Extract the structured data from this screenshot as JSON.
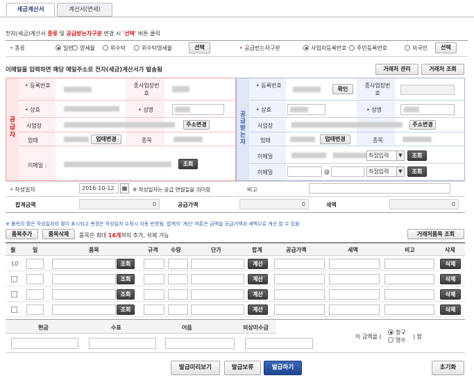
{
  "tabs": [
    "세금계산서",
    "계산서(면세)"
  ],
  "notice": {
    "p1": "전자(세금)계산서 ",
    "k1": "종류",
    "p2": " 및 ",
    "k2": "공급받는자구분",
    "p3": " 변경 시 ",
    "k3": "'선택'",
    "p4": " 버튼 클릭"
  },
  "kind": {
    "label": "종류",
    "options": [
      "일반",
      "영세율",
      "위수탁",
      "위수탁영세율"
    ],
    "selected": "일반",
    "button": "선택"
  },
  "recipient_type": {
    "label": "공급받는자구분",
    "options": [
      "사업자등록번호",
      "주민등록번호",
      "외국인"
    ],
    "selected": "사업자등록번호",
    "button": "선택"
  },
  "email_notice": "이메일을 입력하면 해당 메일주소로 전자(세금)계산서가 발송됨",
  "top_buttons": {
    "manage": "거래처 관리",
    "search": "거래처 조회"
  },
  "supplier": {
    "side_label": "공급자",
    "reg_no": "등록번호",
    "sub_no": "종사업장번호",
    "name": "상호",
    "ceo": "성명",
    "address": "사업장",
    "address_btn": "주소변경",
    "type": "업태",
    "type_btn": "업태변경",
    "item": "종목",
    "email": "이메일",
    "email_btn": "조회"
  },
  "buyer": {
    "side_label": "공급받는자",
    "reg_no": "등록번호",
    "confirm": "확인",
    "sub_no": "종사업장번호",
    "name": "상호",
    "ceo": "성명",
    "address": "사업장",
    "address_btn": "주소변경",
    "type": "업태",
    "type_btn": "업태변경",
    "item": "종목",
    "email": "이메일",
    "email2": "이메일",
    "at": "@",
    "direct": "직접입력",
    "email_btn": "조회"
  },
  "date": {
    "label": "작성일자",
    "value": "2016-10-12",
    "note": "※ 작성일자는 공급 연월일을 의미함",
    "memo": "비고"
  },
  "totals": {
    "total": "합계금액",
    "total_value": "0",
    "supply": "공급가액",
    "supply_value": "0",
    "tax": "세액",
    "tax_value": "0"
  },
  "items_notice": "※ 품목의 월은 작성일자의 월이 표시되고 변경은 작성일자 수정시 자동 반영됨, 합계의 '계산' 버튼은 금액을 공급가액과 세액으로 계산 할 수 있음",
  "items_controls": {
    "add": "품목추가",
    "del": "품목삭제",
    "max_text1": "품목은 최대 ",
    "max_num": "16개",
    "max_text2": "까지 추가, 삭제 가능",
    "lookup": "거래처품목 조회"
  },
  "columns": [
    "월",
    "일",
    "품목",
    "규격",
    "수량",
    "단가",
    "합계",
    "공급가액",
    "세액",
    "비고",
    "삭제"
  ],
  "rows": [
    {
      "month": "10"
    },
    {
      "month": ""
    },
    {
      "month": ""
    },
    {
      "month": ""
    }
  ],
  "row_buttons": {
    "lookup": "조회",
    "calc": "계산",
    "delete": "삭제"
  },
  "payment": {
    "cash": "현금",
    "check": "수표",
    "note": "어음",
    "credit": "외상미수금"
  },
  "amount": {
    "prefix": "이 금액을 (",
    "opt1": "청구",
    "opt2": "영수",
    "suffix": ") 함",
    "selected": "청구"
  },
  "footer": {
    "preview": "발급미리보기",
    "hold": "발급보류",
    "issue": "발급하기",
    "reset": "초기화"
  }
}
